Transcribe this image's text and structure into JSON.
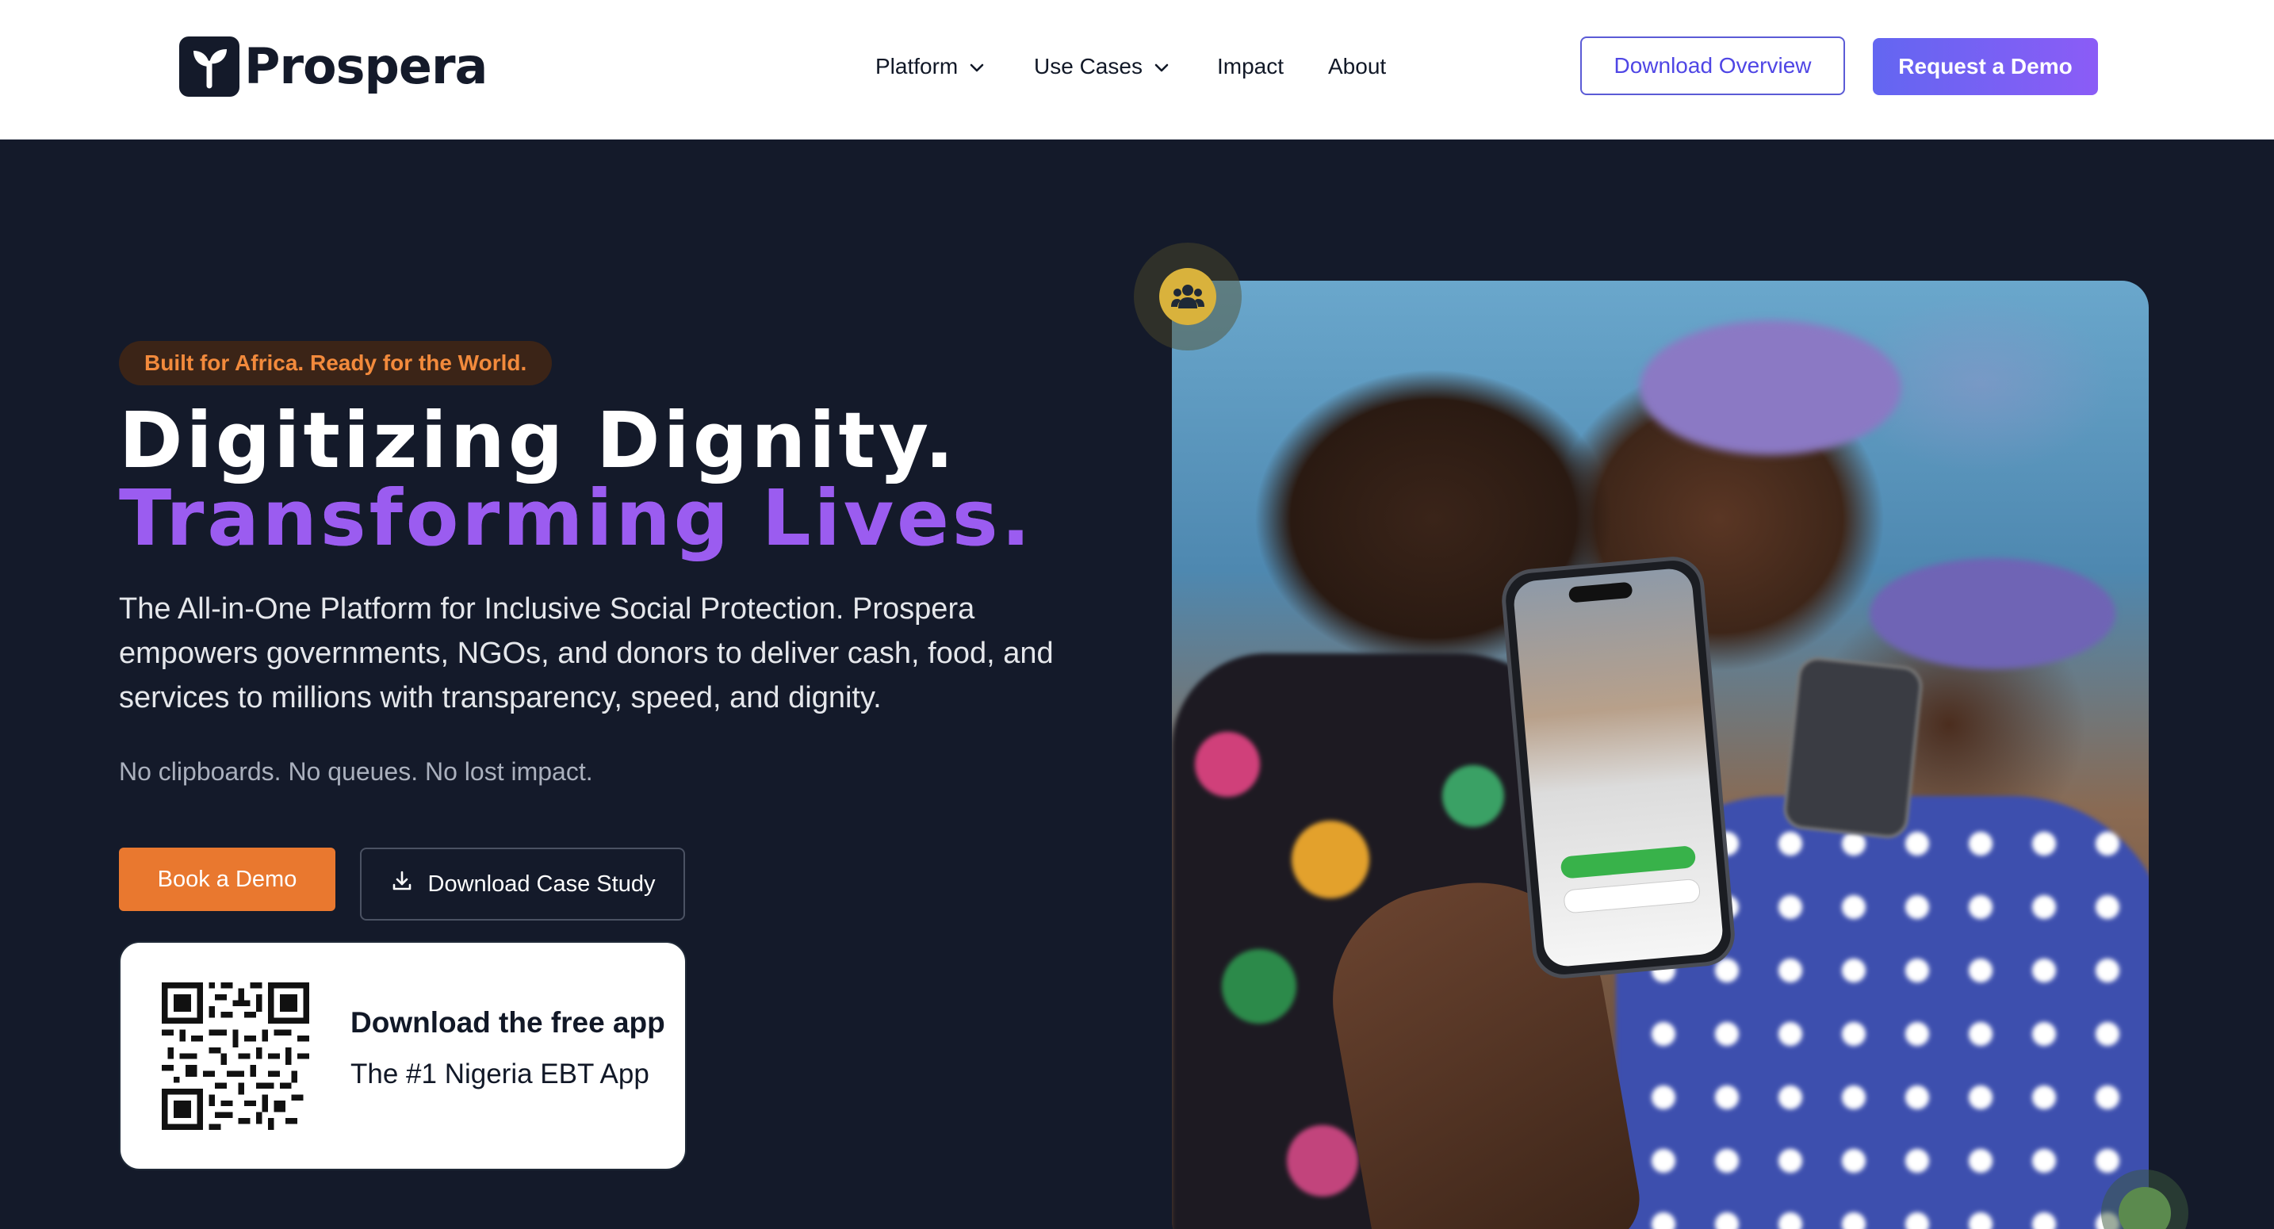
{
  "brand": {
    "name": "Prospera"
  },
  "nav": {
    "items": [
      {
        "label": "Platform",
        "has_dropdown": true
      },
      {
        "label": "Use Cases",
        "has_dropdown": true
      },
      {
        "label": "Impact",
        "has_dropdown": false
      },
      {
        "label": "About",
        "has_dropdown": false
      }
    ],
    "download_overview": "Download Overview",
    "request_demo": "Request a Demo"
  },
  "hero": {
    "badge": "Built for Africa. Ready for the World.",
    "headline_line1": "Digitizing Dignity.",
    "headline_line2": "Transforming Lives.",
    "lead": "The All-in-One Platform for Inclusive Social Protection. Prospera empowers governments, NGOs, and donors to deliver cash, food, and services to millions with transparency, speed, and dignity.",
    "tagline": "No clipboards. No queues. No lost impact.",
    "book_demo": "Book a Demo",
    "download_case_study": "Download Case Study",
    "app_card": {
      "title": "Download the free app",
      "subtitle": "The #1 Nigeria EBT App"
    }
  },
  "icons": {
    "logo": "sprout-icon",
    "chevron": "chevron-down-icon",
    "download": "download-icon",
    "community": "users-icon"
  },
  "colors": {
    "accent_orange": "#e9782f",
    "accent_purple": "#8b5cf6",
    "hero_bg": "#141a2a",
    "badge_text": "#f28a3c"
  }
}
